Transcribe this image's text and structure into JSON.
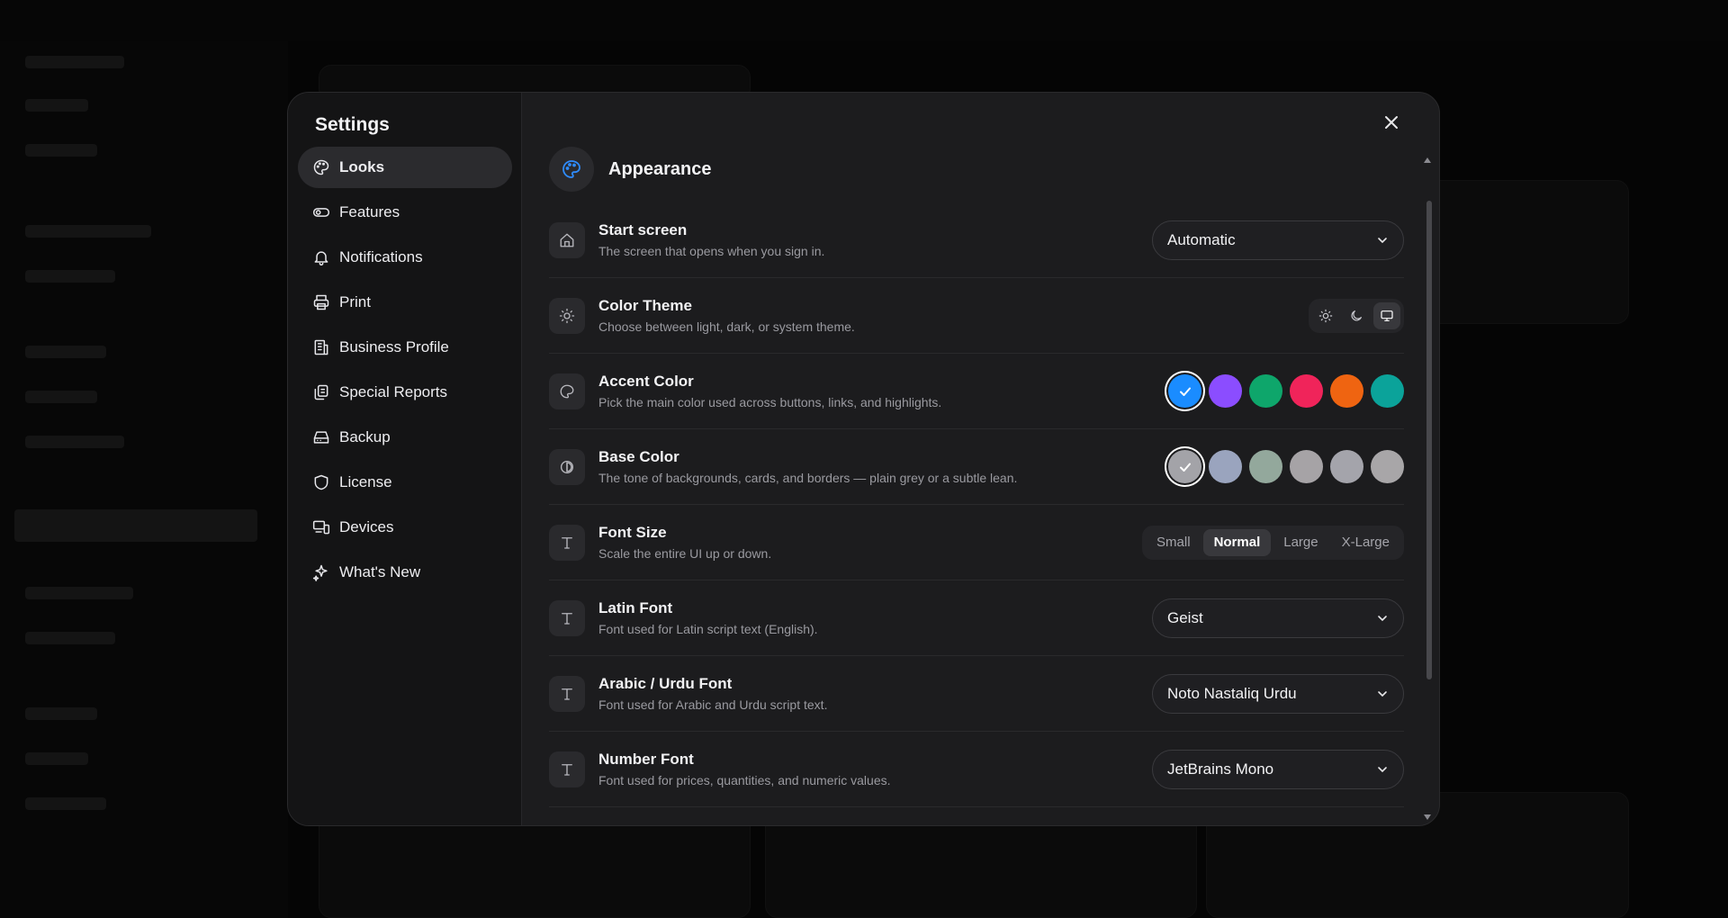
{
  "settings": {
    "title": "Settings",
    "close_icon": "close-icon",
    "nav": [
      {
        "label": "Looks",
        "icon": "palette-icon",
        "active": true
      },
      {
        "label": "Features",
        "icon": "toggle-icon",
        "active": false
      },
      {
        "label": "Notifications",
        "icon": "bell-icon",
        "active": false
      },
      {
        "label": "Print",
        "icon": "printer-icon",
        "active": false
      },
      {
        "label": "Business Profile",
        "icon": "building-icon",
        "active": false
      },
      {
        "label": "Special Reports",
        "icon": "reports-icon",
        "active": false
      },
      {
        "label": "Backup",
        "icon": "hard-drive-icon",
        "active": false
      },
      {
        "label": "License",
        "icon": "shield-icon",
        "active": false
      },
      {
        "label": "Devices",
        "icon": "devices-icon",
        "active": false
      },
      {
        "label": "What's New",
        "icon": "sparkles-icon",
        "active": false
      }
    ]
  },
  "appearance": {
    "title": "Appearance",
    "start_screen": {
      "title": "Start screen",
      "desc": "The screen that opens when you sign in.",
      "value": "Automatic"
    },
    "color_theme": {
      "title": "Color Theme",
      "desc": "Choose between light, dark, or system theme.",
      "options": [
        "sun-icon",
        "moon-icon",
        "monitor-icon"
      ],
      "selected": "monitor-icon"
    },
    "accent_color": {
      "title": "Accent Color",
      "desc": "Pick the main color used across buttons, links, and highlights.",
      "colors": [
        "#1a8cff",
        "#8b4dff",
        "#0ea66b",
        "#f0245a",
        "#ef6411",
        "#0ba39a"
      ],
      "selected_index": 0
    },
    "base_color": {
      "title": "Base Color",
      "desc": "The tone of backgrounds, cards, and borders — plain grey or a subtle lean.",
      "colors": [
        "#a3a3a8",
        "#9aa4be",
        "#93a89c",
        "#a6a3a6",
        "#a4a4ab",
        "#a8a6a8"
      ],
      "selected_index": 0
    },
    "font_size": {
      "title": "Font Size",
      "desc": "Scale the entire UI up or down.",
      "options": [
        "Small",
        "Normal",
        "Large",
        "X-Large"
      ],
      "selected": "Normal"
    },
    "latin_font": {
      "title": "Latin Font",
      "desc": "Font used for Latin script text (English).",
      "value": "Geist"
    },
    "arabic_font": {
      "title": "Arabic / Urdu Font",
      "desc": "Font used for Arabic and Urdu script text.",
      "value": "Noto Nastaliq Urdu"
    },
    "number_font": {
      "title": "Number Font",
      "desc": "Font used for prices, quantities, and numeric values.",
      "value": "JetBrains Mono"
    }
  }
}
